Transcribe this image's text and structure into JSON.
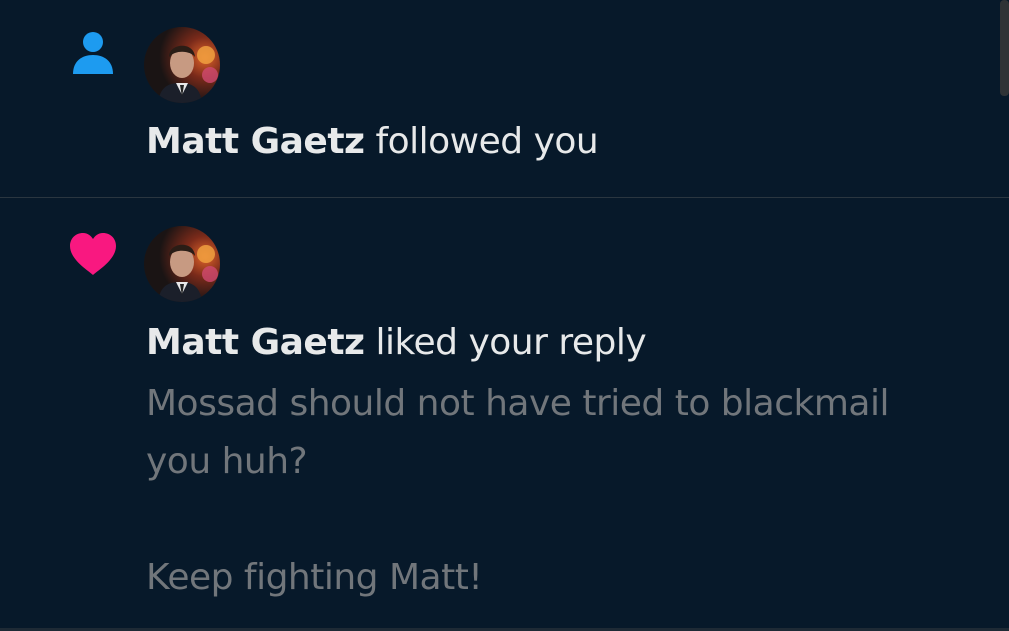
{
  "notifications": [
    {
      "type": "follow",
      "icon": "person-icon",
      "icon_color": "#1d9bf0",
      "name": "Matt Gaetz",
      "action": "followed you"
    },
    {
      "type": "like",
      "icon": "heart-icon",
      "icon_color": "#f91880",
      "name": "Matt Gaetz",
      "action": "liked your reply",
      "reply_line1": "Mossad should not have tried to blackmail",
      "reply_line2": "you huh?",
      "reply_line3": "Keep fighting Matt!"
    }
  ],
  "colors": {
    "background": "#07192a",
    "primary_text": "#e7e9ea",
    "secondary_text": "#71767b",
    "divider": "#2a3640"
  }
}
